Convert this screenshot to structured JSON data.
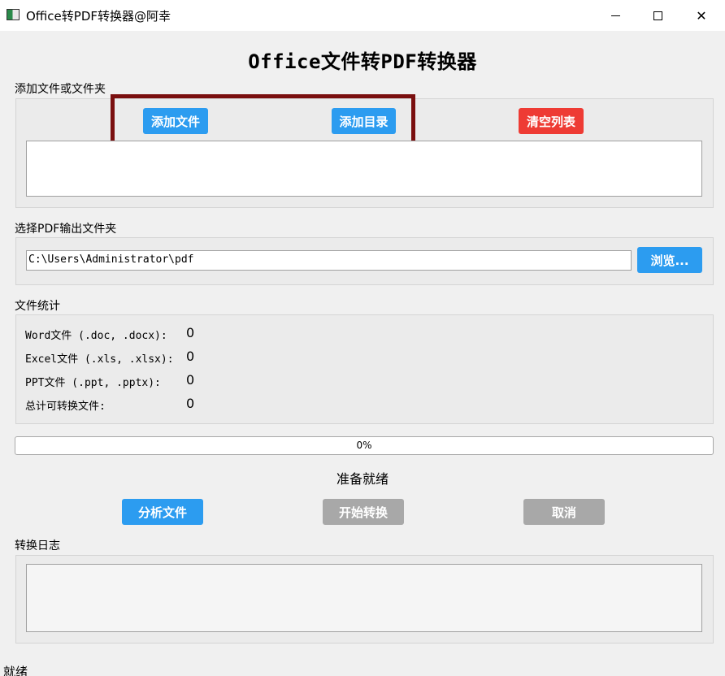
{
  "window": {
    "title": "Office转PDF转换器@阿幸",
    "icon": "app-window-icon"
  },
  "header": {
    "title": "Office文件转PDF转换器"
  },
  "add_section": {
    "label": "添加文件或文件夹",
    "add_file_label": "添加文件",
    "add_dir_label": "添加目录",
    "clear_label": "清空列表",
    "file_list": []
  },
  "output_section": {
    "label": "选择PDF输出文件夹",
    "path": "C:\\Users\\Administrator\\pdf",
    "browse_label": "浏览..."
  },
  "stats_section": {
    "label": "文件统计",
    "rows": [
      {
        "label": "Word文件 (.doc, .docx):",
        "value": "0"
      },
      {
        "label": "Excel文件 (.xls, .xlsx):",
        "value": "0"
      },
      {
        "label": "PPT文件 (.ppt, .pptx):",
        "value": "0"
      },
      {
        "label": "总计可转换文件:",
        "value": "0"
      }
    ]
  },
  "progress": {
    "value": 0,
    "text": "0%"
  },
  "status": {
    "message": "准备就绪"
  },
  "actions": {
    "analyze_label": "分析文件",
    "start_label": "开始转换",
    "cancel_label": "取消"
  },
  "log_section": {
    "label": "转换日志",
    "content": ""
  },
  "statusbar": {
    "text": "就绪"
  },
  "colors": {
    "primary_button": "#2c9cf0",
    "danger_button": "#ee3b34",
    "disabled_button": "#a8a8a8",
    "highlight_border": "#7a0f0f"
  }
}
